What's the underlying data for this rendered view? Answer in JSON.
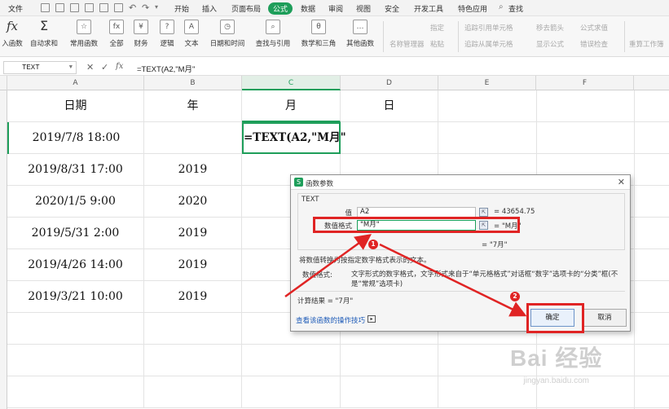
{
  "menubar": {
    "file": "文件",
    "tabs": [
      "开始",
      "插入",
      "页面布局",
      "公式",
      "数据",
      "审阅",
      "视图",
      "安全",
      "开发工具",
      "特色应用"
    ],
    "active_tab": "公式",
    "search": "查找"
  },
  "ribbon": {
    "big": [
      {
        "label": "入函数",
        "icon": "fx"
      },
      {
        "label": "自动求和",
        "icon": "Σ"
      },
      {
        "label": "常用函数",
        "icon": "☆"
      },
      {
        "label": "全部",
        "icon": "fx"
      },
      {
        "label": "财务",
        "icon": "¥"
      },
      {
        "label": "逻辑",
        "icon": "?"
      },
      {
        "label": "文本",
        "icon": "A"
      },
      {
        "label": "日期和时间",
        "icon": "◷"
      },
      {
        "label": "查找与引用",
        "icon": "⌕"
      },
      {
        "label": "数学和三角",
        "icon": "θ"
      },
      {
        "label": "其他函数",
        "icon": "…"
      }
    ],
    "name_manager": "名称管理器",
    "paste": "粘贴",
    "define": "指定",
    "trace_precedents": "追踪引用单元格",
    "trace_dependents": "追踪从属单元格",
    "remove_arrows": "移去箭头",
    "show_formulas": "显示公式",
    "evaluate": "公式求值",
    "error_check": "错误检查",
    "recalc": "重算工作簿"
  },
  "formula_bar": {
    "name_box": "TEXT",
    "cancel": "✕",
    "enter": "✓",
    "fx": "fx",
    "formula": "=TEXT(A2,\"M月\""
  },
  "grid": {
    "columns": [
      "A",
      "B",
      "C",
      "D",
      "E",
      "F"
    ],
    "selected_column": "C",
    "header_row": [
      "日期",
      "年",
      "月",
      "日"
    ],
    "rows": [
      [
        "2019/7/8 18:00",
        "",
        "=TEXT(A2,\"M月\"",
        ""
      ],
      [
        "2019/8/31 17:00",
        "2019",
        "",
        ""
      ],
      [
        "2020/1/5 9:00",
        "2020",
        "",
        ""
      ],
      [
        "2019/5/31 2:00",
        "2019",
        "",
        ""
      ],
      [
        "2019/4/26 14:00",
        "2019",
        "",
        ""
      ],
      [
        "2019/3/21 10:00",
        "2019",
        "",
        ""
      ]
    ]
  },
  "dialog": {
    "title": "函数参数",
    "function_name": "TEXT",
    "arg1_label": "值",
    "arg1_value": "A2",
    "arg1_eval": "= 43654.75",
    "arg2_label": "数值格式",
    "arg2_value": "\"M月\"",
    "arg2_eval": "= \"M月\"",
    "result_mid": "= \"7月\"",
    "description": "将数值转换为按指定数字格式表示的文本。",
    "param_desc_label": "数值格式:",
    "param_desc": "文字形式的数字格式，文字形式来自于“单元格格式”对话框“数字”选项卡的“分类”框(不是“常规”选项卡)",
    "calc_result": "计算结果 = \"7月\"",
    "help_link": "查看该函数的操作技巧",
    "ok": "确定",
    "cancel": "取消"
  },
  "annotations": {
    "badge1": "1",
    "badge2": "2",
    "highlight_color": "#e02424"
  },
  "watermark": {
    "brand": "Bai 经验",
    "url": "jingyan.baidu.com"
  },
  "colors": {
    "accent": "#1e9e5a",
    "annotation": "#e02424",
    "link": "#1e5bb8"
  }
}
